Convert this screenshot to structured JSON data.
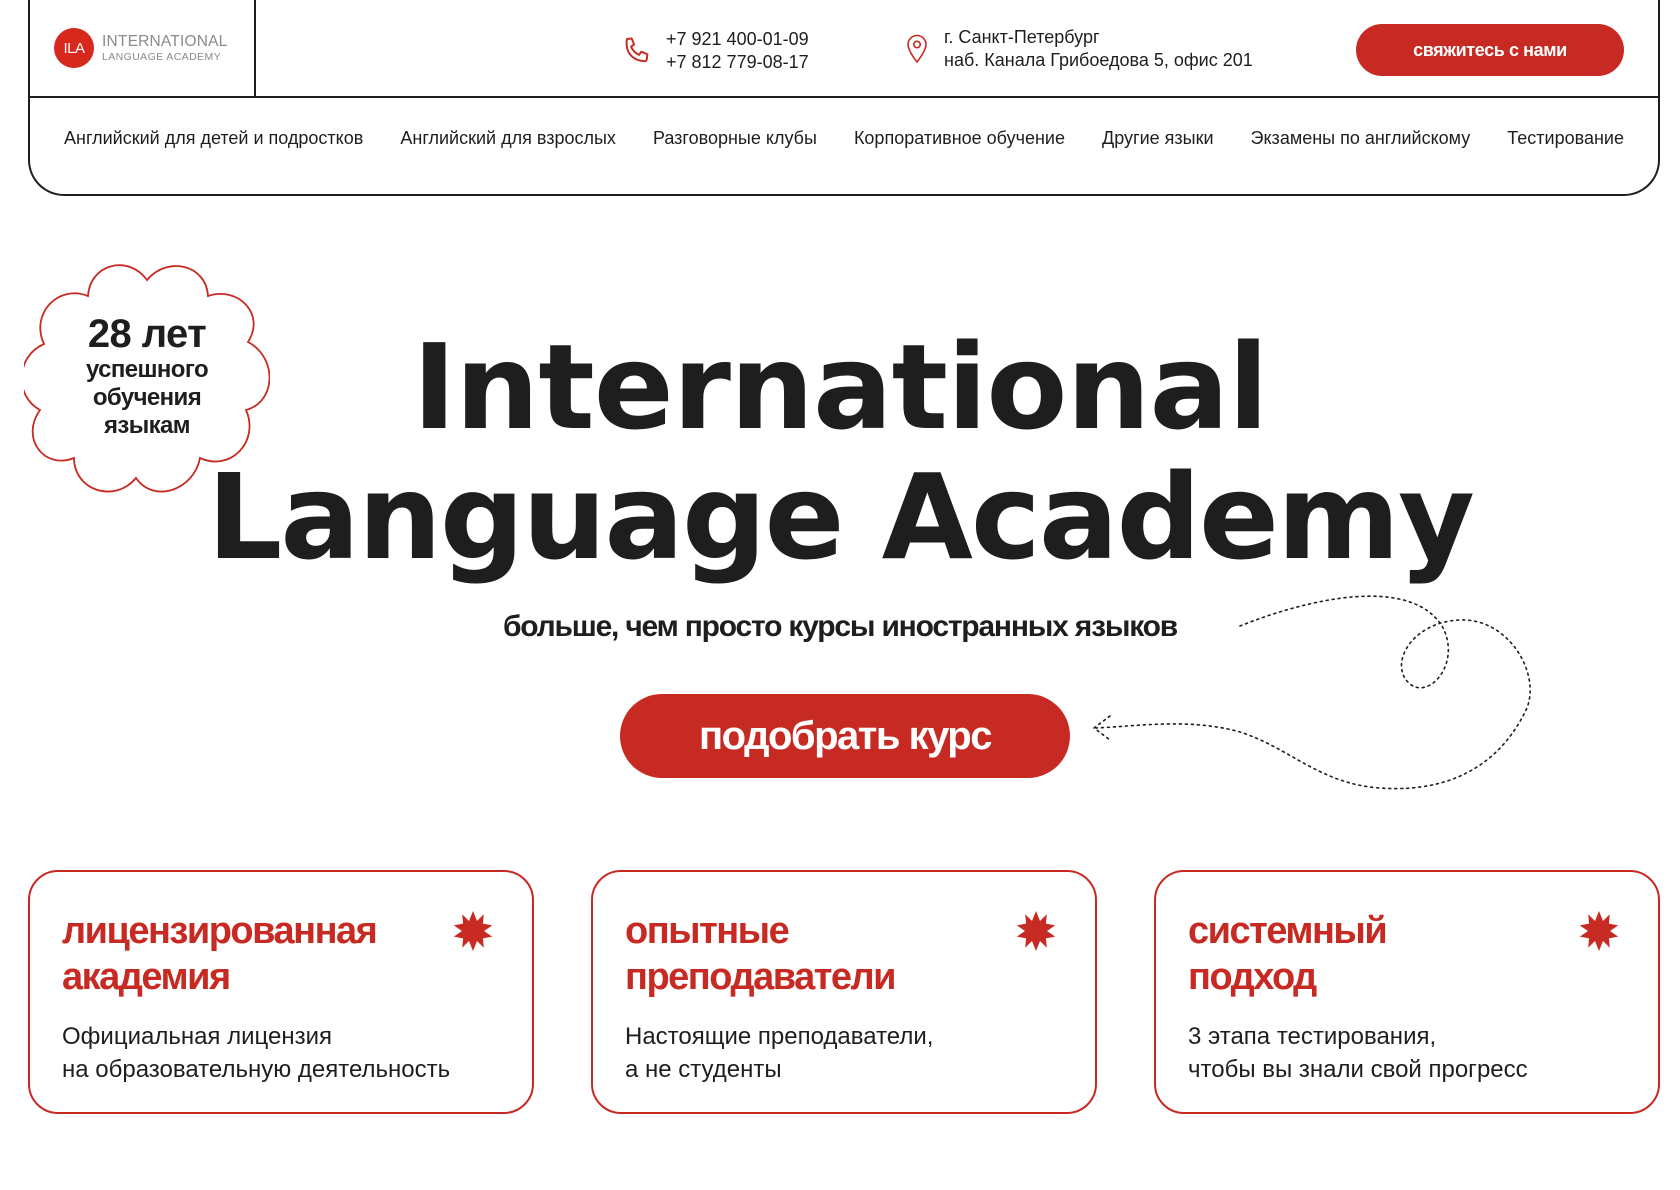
{
  "brand": {
    "logo_mark": "ILA",
    "name_line1": "INTERNATIONAL",
    "name_line2": "LANGUAGE ACADEMY"
  },
  "contacts": {
    "phone_1": "+7 921 400-01-09",
    "phone_2": "+7 812 779-08-17",
    "city": "г. Санкт-Петербург",
    "address": "наб. Канала Грибоедова 5, офис 201",
    "contact_button": "свяжитесь с нами"
  },
  "nav": {
    "items": [
      "Английский для детей и подростков",
      "Английский для взрослых",
      "Разговорные клубы",
      "Корпоративное обучение",
      "Другие языки",
      "Экзамены по английскому",
      "Тестирование"
    ]
  },
  "badge": {
    "years": "28 лет",
    "line1": "успешного",
    "line2": "обучения",
    "line3": "языкам"
  },
  "hero": {
    "title_line1": "International",
    "title_line2": "Language Academy",
    "subtitle": "больше, чем просто курсы иностранных языков",
    "cta": "подобрать курс"
  },
  "features": [
    {
      "title_line1": "лицензированная",
      "title_line2": "академия",
      "desc_line1": "Официальная лицензия",
      "desc_line2": "на образовательную деятельность"
    },
    {
      "title_line1": "опытные",
      "title_line2": "преподаватели",
      "desc_line1": "Настоящие преподаватели,",
      "desc_line2": "а не студенты"
    },
    {
      "title_line1": "системный",
      "title_line2": "подход",
      "desc_line1": "3 этапа тестирования,",
      "desc_line2": "чтобы вы знали свой прогресс"
    }
  ],
  "colors": {
    "accent": "#c72a22",
    "logo_red": "#d6281d",
    "text": "#1e1e1e",
    "border": "#1e1e1e"
  },
  "icons": {
    "phone": "phone-icon",
    "location": "location-pin-icon",
    "feature_star": "asterisk-star-icon",
    "badge_shape": "flower-badge-shape",
    "decor": "dotted-squiggle-arrow"
  }
}
